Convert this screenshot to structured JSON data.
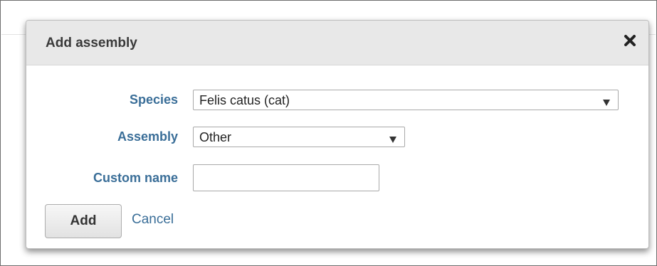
{
  "dialog": {
    "title": "Add assembly",
    "close_icon": "close-icon",
    "fields": {
      "species": {
        "label": "Species",
        "selected": "Felis catus (cat)",
        "arrow_icon": "triangle-down-icon"
      },
      "assembly": {
        "label": "Assembly",
        "selected": "Other",
        "arrow_icon": "triangle-down-icon"
      },
      "custom_name": {
        "label": "Custom name",
        "value": "",
        "placeholder": ""
      }
    },
    "actions": {
      "add_label": "Add",
      "cancel_label": "Cancel"
    }
  },
  "colors": {
    "label_blue": "#3a6e98",
    "header_gray": "#e8e8e8",
    "title_text": "#3a3a3a"
  }
}
